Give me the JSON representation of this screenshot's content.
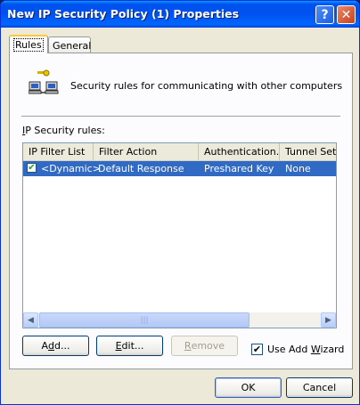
{
  "window": {
    "title": "New IP Security Policy (1) Properties",
    "help_glyph": "?",
    "close_glyph": "✕"
  },
  "tabs": [
    {
      "label": "Rules",
      "selected": true
    },
    {
      "label": "General",
      "selected": false
    }
  ],
  "info": {
    "icon": "network-computers-key-icon",
    "text": "Security rules for communicating with other computers"
  },
  "rules_section": {
    "label_accel": "I",
    "label_rest": "P Security rules:"
  },
  "list": {
    "columns": [
      "IP Filter List",
      "Filter Action",
      "Authentication...",
      "Tunnel Setting"
    ],
    "rows": [
      {
        "checked": true,
        "selected": true,
        "filter_list": "<Dynamic>",
        "filter_action": "Default Response",
        "authentication": "Preshared Key",
        "tunnel": "None"
      }
    ]
  },
  "buttons": {
    "add": {
      "accel": "d",
      "pre": "A",
      "post": "d..."
    },
    "edit": {
      "accel": "E",
      "post": "dit..."
    },
    "remove": {
      "accel": "R",
      "post": "emove",
      "disabled": true
    },
    "ok": "OK",
    "cancel": "Cancel"
  },
  "wizard": {
    "checked": true,
    "label_pre": "Use Add ",
    "label_accel": "W",
    "label_post": "izard"
  },
  "colors": {
    "selection": "#316ac5",
    "title_blue": "#0050ee",
    "dialog_bg": "#ece9d8"
  }
}
